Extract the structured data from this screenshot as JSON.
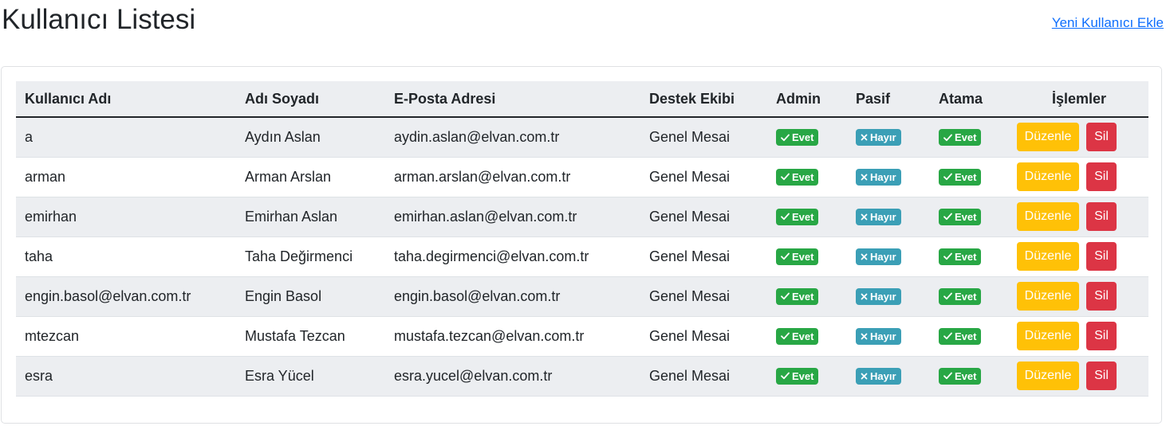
{
  "page": {
    "title": "Kullanıcı Listesi",
    "add_link": "Yeni Kullanıcı Ekle"
  },
  "table": {
    "headers": [
      "Kullanıcı Adı",
      "Adı Soyadı",
      "E-Posta Adresi",
      "Destek Ekibi",
      "Admin",
      "Pasif",
      "Atama",
      "İşlemler"
    ],
    "rows": [
      {
        "username": "a",
        "fullname": "Aydın Aslan",
        "email": "aydin.aslan@elvan.com.tr",
        "team": "Genel Mesai",
        "admin": "Evet",
        "pasif": "Hayır",
        "atama": "Evet"
      },
      {
        "username": "arman",
        "fullname": "Arman Arslan",
        "email": "arman.arslan@elvan.com.tr",
        "team": "Genel Mesai",
        "admin": "Evet",
        "pasif": "Hayır",
        "atama": "Evet"
      },
      {
        "username": "emirhan",
        "fullname": "Emirhan Aslan",
        "email": "emirhan.aslan@elvan.com.tr",
        "team": "Genel Mesai",
        "admin": "Evet",
        "pasif": "Hayır",
        "atama": "Evet"
      },
      {
        "username": "taha",
        "fullname": "Taha Değirmenci",
        "email": "taha.degirmenci@elvan.com.tr",
        "team": "Genel Mesai",
        "admin": "Evet",
        "pasif": "Hayır",
        "atama": "Evet"
      },
      {
        "username": "engin.basol@elvan.com.tr",
        "fullname": "Engin Basol",
        "email": "engin.basol@elvan.com.tr",
        "team": "Genel Mesai",
        "admin": "Evet",
        "pasif": "Hayır",
        "atama": "Evet"
      },
      {
        "username": "mtezcan",
        "fullname": "Mustafa Tezcan",
        "email": "mustafa.tezcan@elvan.com.tr",
        "team": "Genel Mesai",
        "admin": "Evet",
        "pasif": "Hayır",
        "atama": "Evet"
      },
      {
        "username": "esra",
        "fullname": "Esra Yücel",
        "email": "esra.yucel@elvan.com.tr",
        "team": "Genel Mesai",
        "admin": "Evet",
        "pasif": "Hayır",
        "atama": "Evet"
      }
    ],
    "actions": {
      "edit_label": "Düzenle",
      "delete_label": "Sil"
    }
  },
  "icons": {
    "yes": "check-icon",
    "no": "x-icon"
  },
  "colors": {
    "yes_badge": "#28a745",
    "no_badge": "#3b9fb6",
    "edit_button": "#ffc107",
    "delete_button": "#dc3545",
    "link": "#0d6efd",
    "stripe": "#eceef1"
  }
}
